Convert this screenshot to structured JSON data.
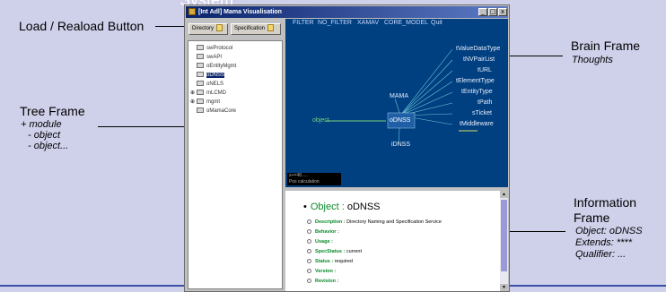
{
  "header_fragment": "System",
  "annotations": {
    "load_reload": "Load / Reaload Button",
    "tree_frame": {
      "title": "Tree Frame",
      "lines": [
        "+ module",
        "- object",
        "- object..."
      ]
    },
    "brain_frame": {
      "title": "Brain Frame",
      "subtitle": "Thoughts"
    },
    "information_frame": {
      "title_line1": "Information",
      "title_line2": "Frame",
      "lines": [
        "Object: oDNSS",
        "Extends: ****",
        "Qualifier: ..."
      ]
    }
  },
  "window": {
    "title": "[Int Adl] Mama Visualisation",
    "controls": [
      "_",
      "□",
      "x"
    ],
    "toolbar": {
      "directory_label": "Directory",
      "specification_label": "Specification"
    }
  },
  "tree": {
    "items": [
      {
        "label": "swProtocol",
        "expander": ""
      },
      {
        "label": "swAPI",
        "expander": ""
      },
      {
        "label": "oEntityMgmt",
        "expander": ""
      },
      {
        "label": "oDNSS",
        "expander": "",
        "selected": true
      },
      {
        "label": "oNELS",
        "expander": ""
      },
      {
        "label": "mLCMD",
        "expander": "⊕"
      },
      {
        "label": "mgmt",
        "expander": "⊕"
      },
      {
        "label": "oMamaCore",
        "expander": ""
      }
    ]
  },
  "brain": {
    "menu": [
      "FILTER",
      "NO_FILTER",
      "XAMAV",
      "CORE_MODEL",
      "Quit"
    ],
    "center_node": "oDNSS",
    "left_node": "object",
    "top_node": "MAMA",
    "bottom_node": "iDNSS",
    "leaf_nodes": [
      "tValueDataType",
      "tNVPairList",
      "tURL",
      "tElementType",
      "tEntityType",
      "tPath",
      "sTicket",
      "tMiddleware"
    ],
    "status_line1": "x+=48.....",
    "status_line2": "Pos  calculation"
  },
  "info": {
    "bullet": "•",
    "object_label": "Object :",
    "object_name": "oDNSS",
    "rows": [
      {
        "key": "Description :",
        "value": "Directory Naming and Specification Service"
      },
      {
        "key": "Behavior :",
        "value": ""
      },
      {
        "key": "Usage :",
        "value": ""
      },
      {
        "key": "SpecStatus :",
        "value": "current"
      },
      {
        "key": "Status :",
        "value": "required"
      },
      {
        "key": "Version :",
        "value": ""
      },
      {
        "key": "Revision :",
        "value": ""
      }
    ]
  },
  "colors": {
    "slide_bg": "#cfd0ea",
    "brain_bg": "#003f80",
    "accent_green": "#0a8a2a",
    "rule_blue": "#3a4fa6"
  }
}
